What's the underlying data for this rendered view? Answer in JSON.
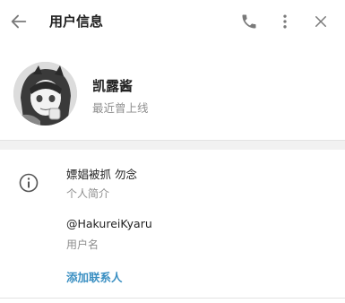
{
  "header": {
    "title": "用户信息",
    "back_icon": "arrow-left-icon",
    "call_icon": "phone-icon",
    "more_icon": "more-vertical-icon",
    "close_icon": "close-icon"
  },
  "profile": {
    "name": "凯露酱",
    "status": "最近曾上线"
  },
  "info": {
    "bio": "嫖娼被抓 勿念",
    "bio_label": "个人简介",
    "username": "@HakureiKyaru",
    "username_label": "用户名",
    "add_contact": "添加联系人"
  },
  "colors": {
    "accent": "#3a8fc2",
    "icon": "#7a7a7a",
    "secondary_text": "#8e8e8e"
  }
}
